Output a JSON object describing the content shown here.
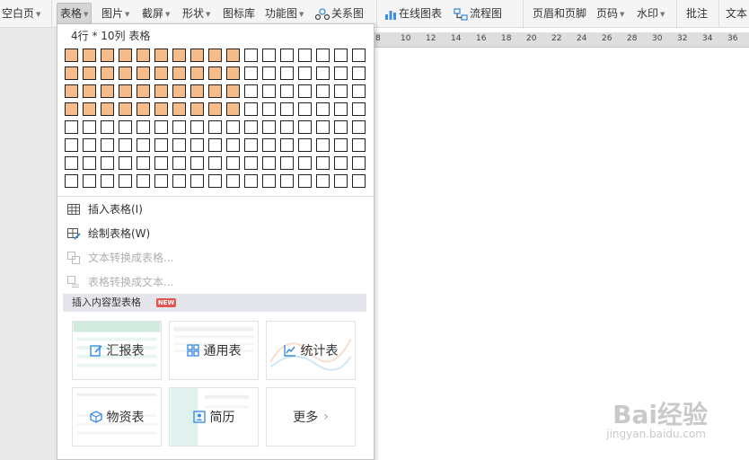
{
  "ribbon": {
    "blank_page": "空白页",
    "table": "表格",
    "picture": "图片",
    "screenshot": "截屏",
    "shape": "形状",
    "icon_lib": "图标库",
    "function_chart": "功能图",
    "relation_chart": "关系图",
    "online_chart": "在线图表",
    "flowchart": "流程图",
    "header_footer": "页眉和页脚",
    "page_number": "页码",
    "watermark": "水印",
    "comment": "批注",
    "textbox": "文本"
  },
  "ruler": {
    "numbers": [
      "8",
      "10",
      "12",
      "14",
      "16",
      "18",
      "20",
      "22",
      "24",
      "26",
      "28",
      "30",
      "32",
      "34",
      "36"
    ]
  },
  "dropdown": {
    "grid_label": "4行 * 10列 表格",
    "grid": {
      "rows": 8,
      "cols": 17,
      "selected_rows": 4,
      "selected_cols": 10
    },
    "menu": {
      "insert_table": "插入表格(I)",
      "draw_table": "绘制表格(W)",
      "text_to_table": "文本转换成表格...",
      "table_to_text": "表格转换成文本..."
    },
    "content_header": "插入内容型表格",
    "new_badge": "NEW",
    "tiles": {
      "report": "汇报表",
      "general": "通用表",
      "statistics": "统计表",
      "materials": "物资表",
      "resume": "简历",
      "more": "更多"
    }
  },
  "watermark_site": {
    "line1": "Bai经验",
    "line2": "jingyan.baidu.com"
  },
  "colors": {
    "selected_cell": "#f6bc8c",
    "accent_icon": "#3e8ee0"
  }
}
